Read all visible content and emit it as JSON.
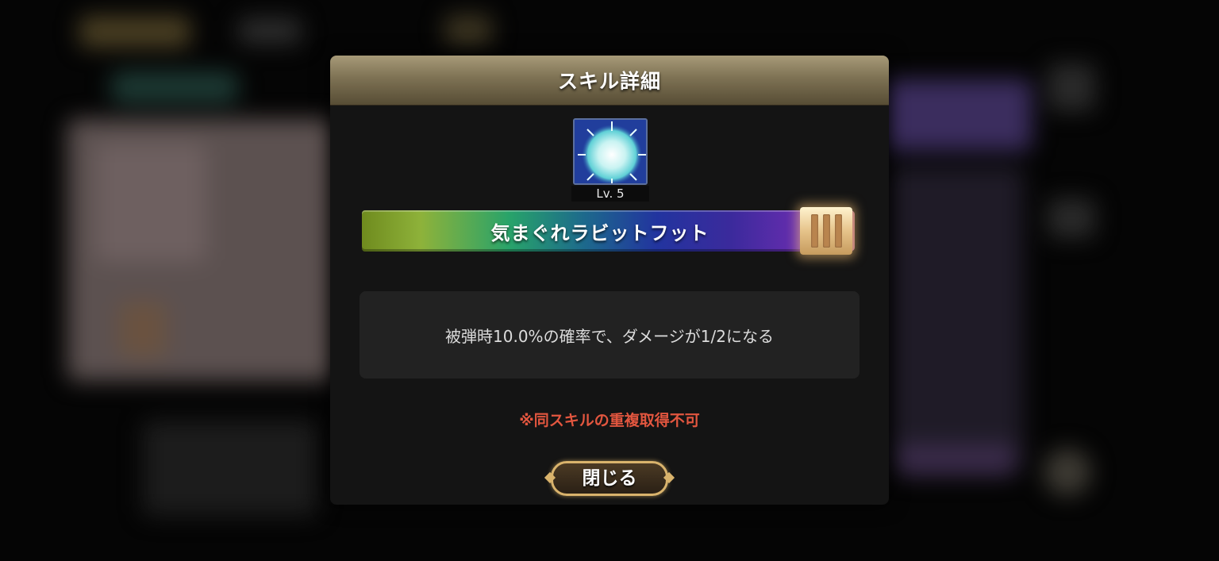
{
  "dialog": {
    "title": "スキル詳細",
    "skill": {
      "icon": "light-burst-icon",
      "level_label": "Lv. 5",
      "name": "気まぐれラビットフット",
      "rank_icon": "rank-three-bars-icon"
    },
    "description": "被弾時10.0%の確率で、ダメージが1/2になる",
    "note": "※同スキルの重複取得不可",
    "close_label": "閉じる"
  },
  "colors": {
    "header_gold": "#8a7d5c",
    "note_red": "#e2563f",
    "button_gold": "#d9b36c"
  }
}
